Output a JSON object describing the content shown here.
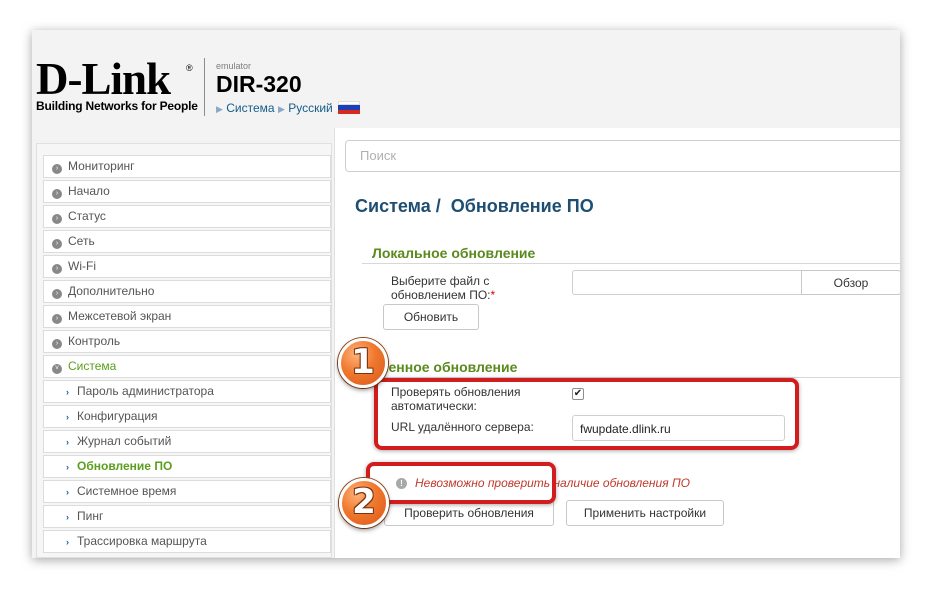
{
  "header": {
    "logo": "D-Link",
    "logo_reg": "®",
    "tagline": "Building Networks for People",
    "emulator": "emulator",
    "model": "DIR-320",
    "crumb_system": "Система",
    "crumb_language": "Русский"
  },
  "sidebar": {
    "items": [
      {
        "label": "Мониторинг"
      },
      {
        "label": "Начало"
      },
      {
        "label": "Статус"
      },
      {
        "label": "Сеть"
      },
      {
        "label": "Wi-Fi"
      },
      {
        "label": "Дополнительно"
      },
      {
        "label": "Межсетевой экран"
      },
      {
        "label": "Контроль"
      },
      {
        "label": "Система"
      }
    ],
    "sub_items": [
      {
        "label": "Пароль администратора"
      },
      {
        "label": "Конфигурация"
      },
      {
        "label": "Журнал событий"
      },
      {
        "label": "Обновление ПО"
      },
      {
        "label": "Системное время"
      },
      {
        "label": "Пинг"
      },
      {
        "label": "Трассировка маршрута"
      }
    ]
  },
  "main": {
    "search_placeholder": "Поиск",
    "title_system": "Система /",
    "title_page": "Обновление ПО",
    "local": {
      "heading": "Локальное обновление",
      "file_label_line1": "Выберите файл с",
      "file_label_line2": "обновлением ПО:",
      "required_mark": "*",
      "browse_button": "Обзор",
      "update_button": "Обновить"
    },
    "remote": {
      "heading": "аленное обновление",
      "auto_check_line1": "Проверять обновления",
      "auto_check_line2": "автоматически:",
      "auto_check_mark": "✔",
      "url_label": "URL удалённого сервера:",
      "url_value": "fwupdate.dlink.ru",
      "warning_icon": "!",
      "warning_text": "Невозможно проверить наличие обновления ПО",
      "check_button": "Проверить обновления",
      "apply_button": "Применить настройки"
    }
  },
  "annotations": {
    "badge1": "1",
    "badge2": "2",
    "highlight_color": "#d11d1d"
  }
}
